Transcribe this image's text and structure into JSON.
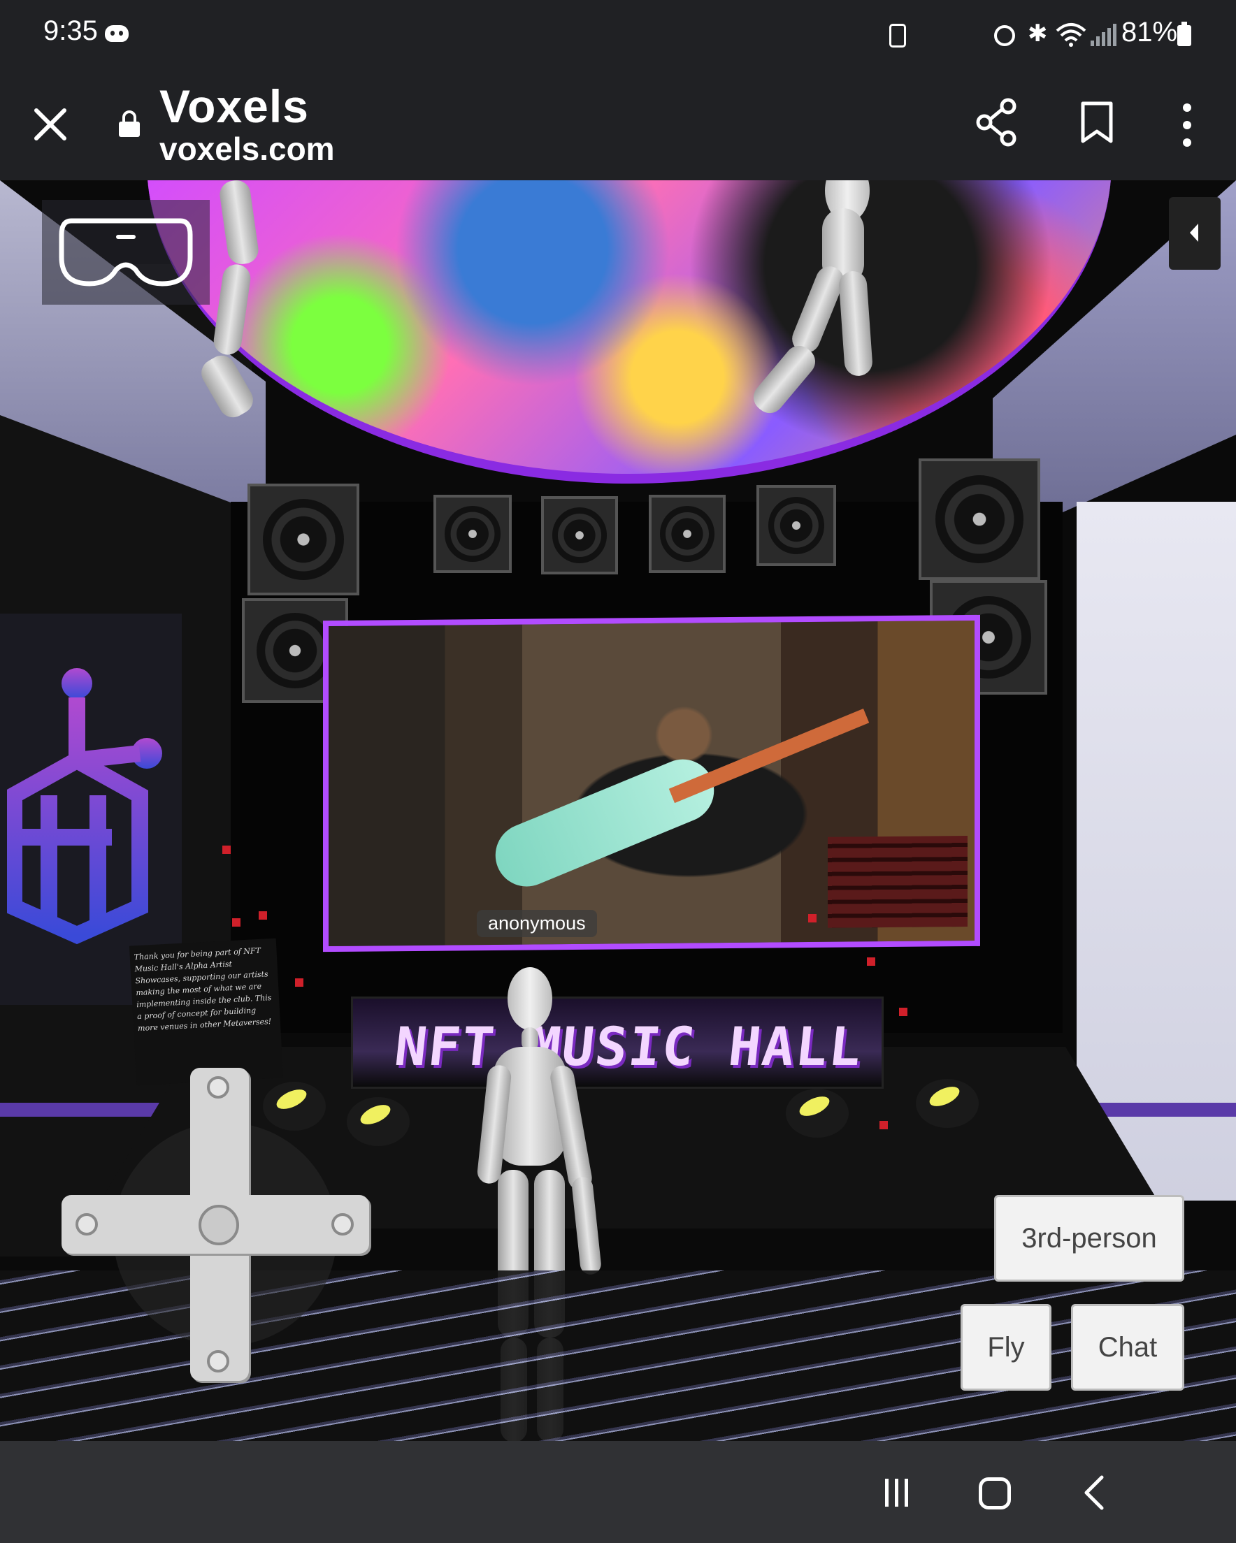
{
  "status_bar": {
    "time": "9:35",
    "battery": "81%",
    "icons": [
      "discord-icon",
      "recycle-icon",
      "alarm-icon",
      "bluetooth-icon",
      "wifi-icon",
      "signal-icon",
      "battery-icon"
    ]
  },
  "browser": {
    "title": "Voxels",
    "url": "voxels.com",
    "icons": [
      "close-icon",
      "lock-icon",
      "share-icon",
      "bookmark-icon",
      "more-vert-icon"
    ]
  },
  "scene": {
    "video_label": "anonymous",
    "marquee": "NFT MUSIC HALL",
    "plaque_text": "Thank you for being part of NFT Music Hall's Alpha Artist Showcases, supporting our artists making the most of what we are implementing inside the club. This a proof of concept for building more venues in other Metaverses!"
  },
  "controls": {
    "third_person": "3rd-person",
    "fly": "Fly",
    "chat": "Chat",
    "icons": [
      "vr-headset-icon",
      "panel-toggle-icon",
      "dpad-icon"
    ]
  },
  "nav_bar": {
    "icons": [
      "recents-icon",
      "home-icon",
      "back-icon"
    ]
  },
  "colors": {
    "accent_purple": "#b24cff",
    "bar_bg": "#202124",
    "nav_bg": "#303134"
  }
}
